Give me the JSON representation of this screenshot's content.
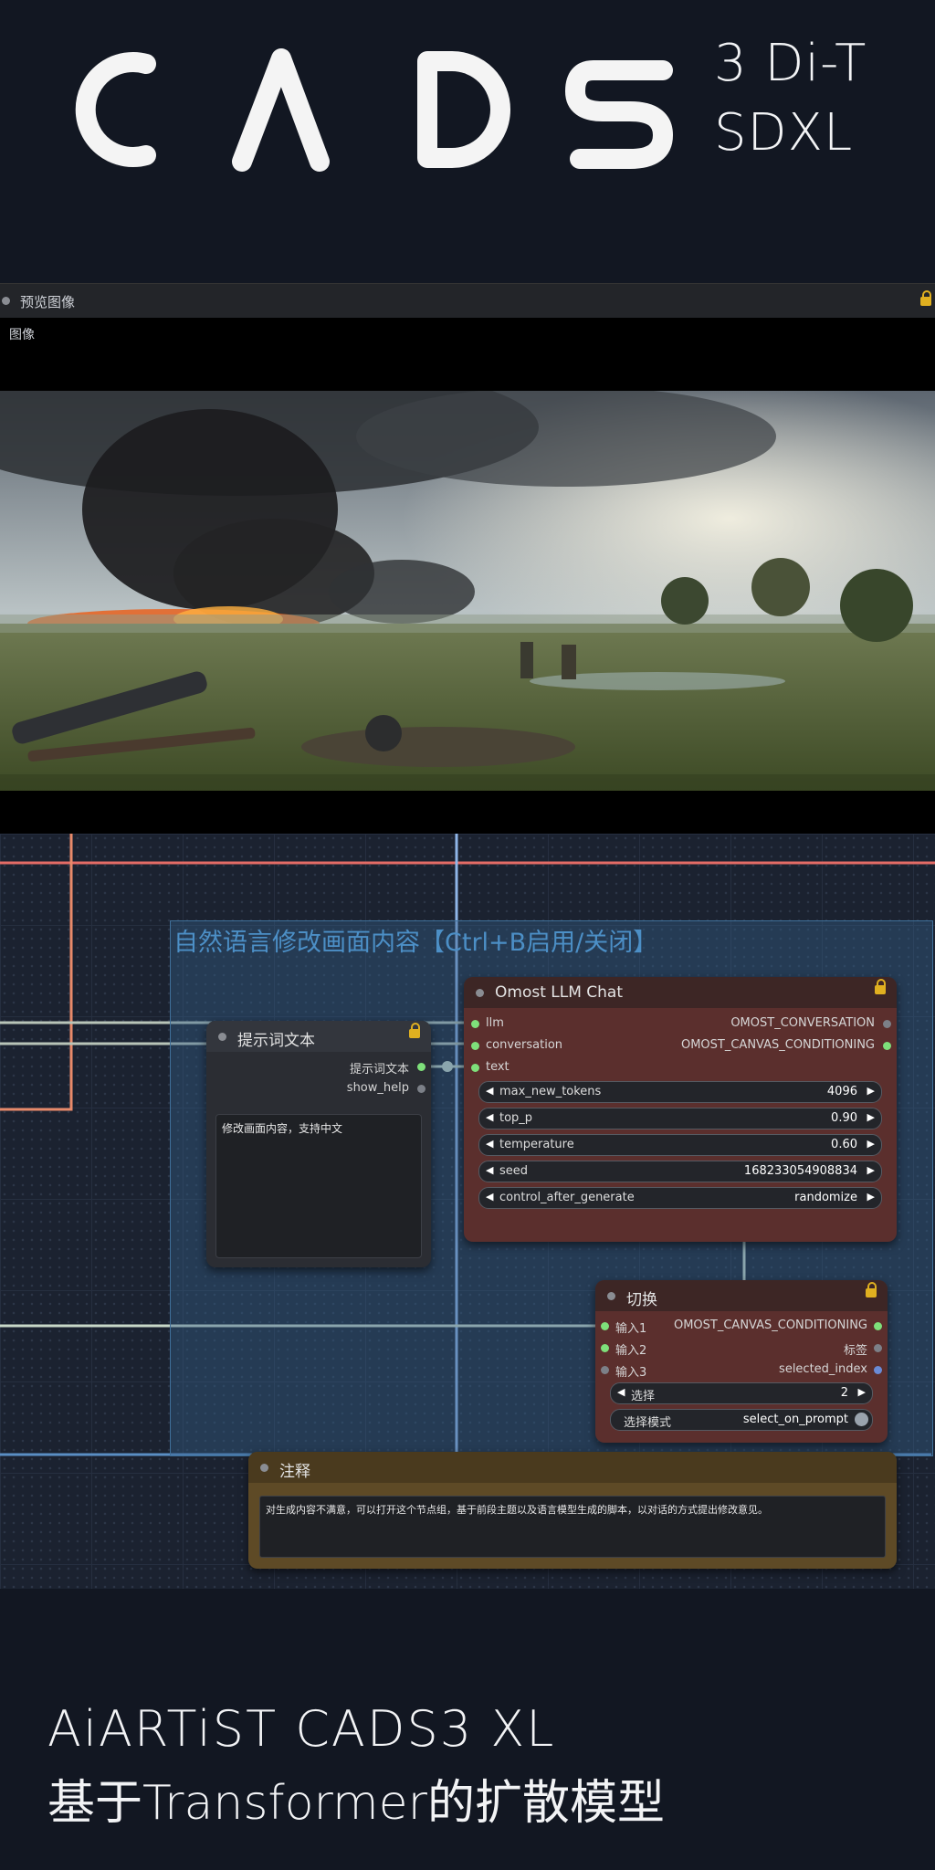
{
  "header": {
    "logo_text": "CADS",
    "line1": "3 Di-T",
    "line2": "SDXL"
  },
  "preview_node": {
    "title": "预览图像",
    "output_label": "图像"
  },
  "group": {
    "title": "自然语言修改画面内容【Ctrl+B启用/关闭】"
  },
  "prompt_node": {
    "title": "提示词文本",
    "outputs": [
      "提示词文本",
      "show_help"
    ],
    "text": "修改画面内容，支持中文"
  },
  "llm_node": {
    "title": "Omost LLM Chat",
    "inputs": [
      "llm",
      "conversation",
      "text"
    ],
    "outputs": [
      "OMOST_CONVERSATION",
      "OMOST_CANVAS_CONDITIONING"
    ],
    "widgets": [
      {
        "label": "max_new_tokens",
        "value": "4096"
      },
      {
        "label": "top_p",
        "value": "0.90"
      },
      {
        "label": "temperature",
        "value": "0.60"
      },
      {
        "label": "seed",
        "value": "168233054908834"
      },
      {
        "label": "control_after_generate",
        "value": "randomize"
      }
    ]
  },
  "switch_node": {
    "title": "切换",
    "inputs": [
      "输入1",
      "输入2",
      "输入3"
    ],
    "outputs": [
      "OMOST_CANVAS_CONDITIONING",
      "标签",
      "selected_index"
    ],
    "select": {
      "label": "选择",
      "value": "2"
    },
    "mode": {
      "label": "选择模式",
      "value": "select_on_prompt"
    }
  },
  "note_node": {
    "title": "注释",
    "text": "对生成内容不满意，可以打开这个节点组，基于前段主题以及语言模型生成的脚本，以对话的方式提出修改意见。"
  },
  "footer": {
    "line1": "AiARTiST CADS3 XL",
    "line2": "基于Transformer的扩散模型"
  },
  "colors": {
    "background": "#121722",
    "llm_node": "#5b2f2d",
    "note_node": "#5e4a26",
    "group": "#346088",
    "link_green": "#7ee07a"
  }
}
